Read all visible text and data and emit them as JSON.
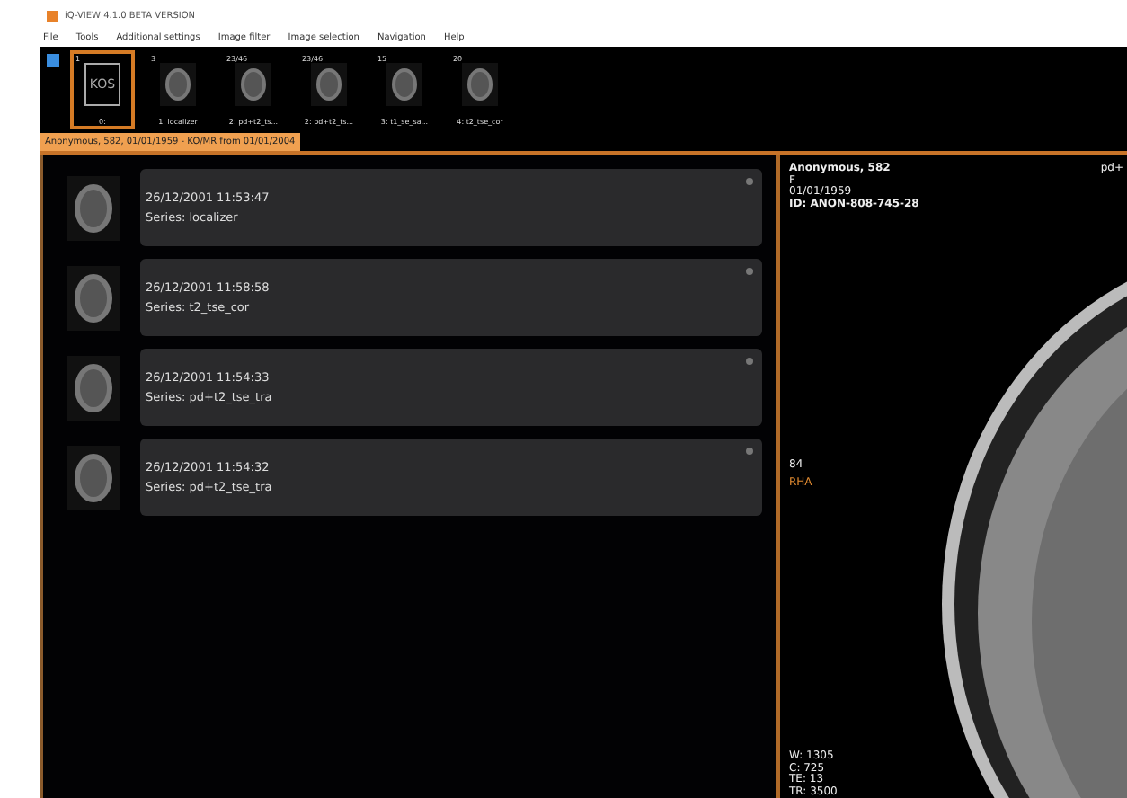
{
  "window": {
    "title": "iQ-VIEW 4.1.0 BETA VERSION"
  },
  "menu": [
    "File",
    "Tools",
    "Additional settings",
    "Image filter",
    "Image selection",
    "Navigation",
    "Help"
  ],
  "thumbnails": [
    {
      "kind": "document",
      "count": "1",
      "label": "0:",
      "selected": true
    },
    {
      "kind": "scan",
      "count": "3",
      "label": "1: localizer",
      "selected": false
    },
    {
      "kind": "scan",
      "count": "23/46",
      "label": "2: pd+t2_ts...",
      "selected": false
    },
    {
      "kind": "scan",
      "count": "23/46",
      "label": "2: pd+t2_ts...",
      "selected": false
    },
    {
      "kind": "scan",
      "count": "15",
      "label": "3: t1_se_sa...",
      "selected": false
    },
    {
      "kind": "scan",
      "count": "20",
      "label": "4: t2_tse_cor",
      "selected": false
    }
  ],
  "document_icon_text": "KOS",
  "study_tab": {
    "label": "Anonymous, 582, 01/01/1959 - KO/MR from 01/01/2004",
    "selected": true
  },
  "series": [
    {
      "time": "26/12/2001 11:53:47",
      "name": "Series: localizer"
    },
    {
      "time": "26/12/2001 11:58:58",
      "name": "Series: t2_tse_cor"
    },
    {
      "time": "26/12/2001 11:54:33",
      "name": "Series: pd+t2_tse_tra"
    },
    {
      "time": "26/12/2001 11:54:32",
      "name": "Series: pd+t2_tse_tra"
    }
  ],
  "viewer": {
    "patient": "Anonymous, 582",
    "sex": "F",
    "birth_date": "01/01/1959",
    "id": "ID: ANON-808-745-28",
    "series_short": "pd+",
    "slice": "84",
    "orientation": "RHA",
    "window": "W: 1305",
    "center": "C: 725",
    "te": "TE: 13",
    "tr": "TR: 3500"
  }
}
